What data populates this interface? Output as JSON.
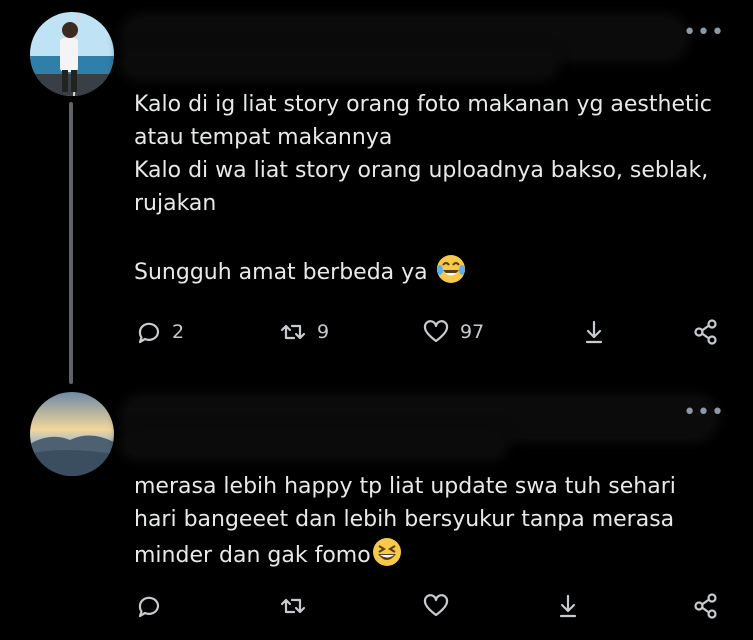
{
  "tweets": [
    {
      "text_lines": [
        "Kalo di ig liat story orang foto makanan yg aesthetic",
        "atau tempat makannya",
        "Kalo di wa liat story orang uploadnya bakso, seblak,",
        "rujakan",
        "",
        "Sungguh amat berbeda ya"
      ],
      "emoji": "face-with-tears-of-joy",
      "more": "•••",
      "actions": {
        "reply_count": "2",
        "retweet_count": "9",
        "like_count": "97"
      }
    },
    {
      "text_lines": [
        "merasa lebih happy tp liat update swa tuh sehari",
        "hari bangeeet dan lebih bersyukur tanpa merasa",
        "minder dan gak fomo"
      ],
      "emoji": "grinning-squinting-face",
      "more": "•••",
      "actions": {
        "reply_count": "",
        "retweet_count": "",
        "like_count": ""
      }
    }
  ],
  "colors": {
    "background": "#000000",
    "text": "#e7e9ea",
    "icon": "#c7cbd0",
    "thread_line": "#5f6266"
  }
}
